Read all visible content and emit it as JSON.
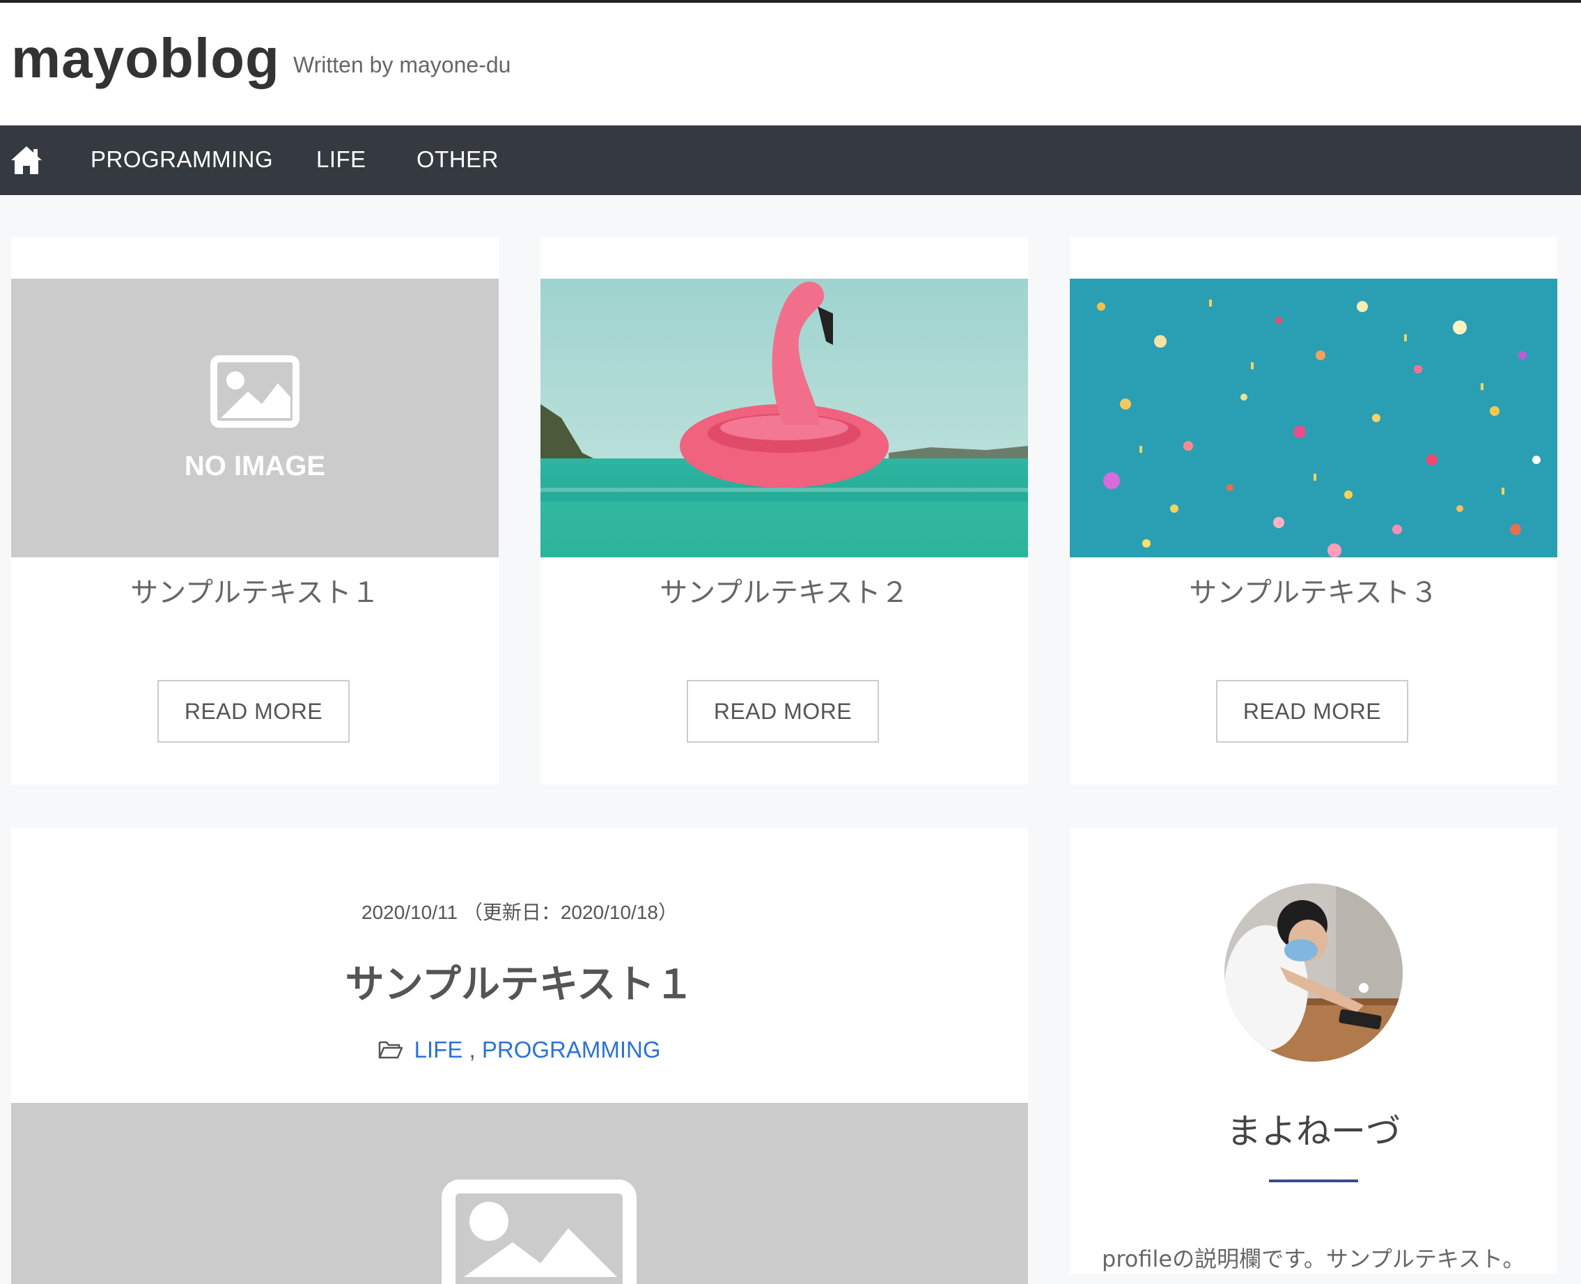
{
  "site": {
    "title": "mayoblog",
    "description": "Written by mayone-du"
  },
  "nav": {
    "home_icon": "home-icon",
    "items": [
      "PROGRAMMING",
      "LIFE",
      "OTHER"
    ]
  },
  "cards": [
    {
      "title": "サンプルテキスト１",
      "button": "READ MORE",
      "image": "no-image-placeholder",
      "placeholder_text": "NO IMAGE"
    },
    {
      "title": "サンプルテキスト２",
      "button": "READ MORE",
      "image": "flamingo-float-photo"
    },
    {
      "title": "サンプルテキスト３",
      "button": "READ MORE",
      "image": "confetti-photo"
    }
  ],
  "post": {
    "date": "2020/10/11 （更新日：2020/10/18）",
    "title": "サンプルテキスト１",
    "category_icon": "folder-open-icon",
    "categories": [
      "LIFE",
      "PROGRAMMING"
    ],
    "category_separator": ",",
    "image": "no-image-placeholder"
  },
  "profile": {
    "avatar": "profile-photo",
    "name": "まよねーづ",
    "description": "profileの説明欄です。サンプルテキスト。"
  },
  "colors": {
    "nav_bg": "#343a40",
    "accent_link": "#2a73d8",
    "profile_line": "#3b4a8a",
    "placeholder_gray": "#cbcbcb"
  }
}
